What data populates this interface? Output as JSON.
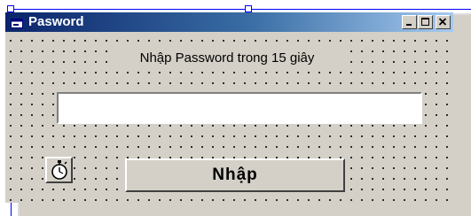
{
  "window": {
    "title": "Pasword",
    "icon": "form-icon",
    "controls": [
      "minimize-icon",
      "maximize-icon",
      "close-icon"
    ]
  },
  "form": {
    "prompt_label": "Nhập Password trong 15 giây",
    "password_input": {
      "value": "",
      "placeholder": ""
    },
    "timer_icon": "stopwatch-icon",
    "enter_button_label": "Nhập"
  },
  "colors": {
    "title_gradient_start": "#0a246a",
    "title_gradient_end": "#a6caf0",
    "face": "#d4d0c8",
    "selection": "#0000ff"
  }
}
